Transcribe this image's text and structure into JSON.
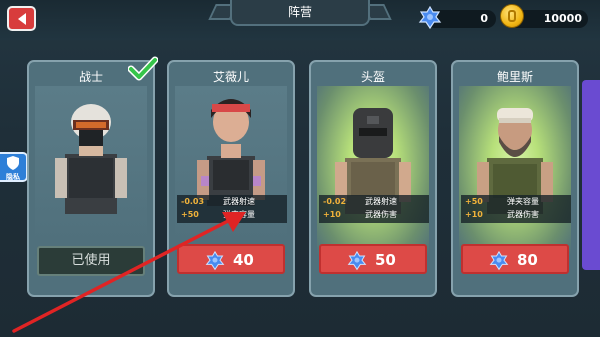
{
  "header": {
    "title": "阵营",
    "gems": "0",
    "coins": "10000"
  },
  "privacy": {
    "label": "隐私"
  },
  "cards": [
    {
      "name": "战士",
      "status": "已使用",
      "stats": []
    },
    {
      "name": "艾薇儿",
      "price": "40",
      "stats": [
        {
          "delta": "-0.03",
          "label": "武器射速"
        },
        {
          "delta": "+50",
          "label": "弹夹容量"
        }
      ]
    },
    {
      "name": "头盔",
      "price": "50",
      "stats": [
        {
          "delta": "-0.02",
          "label": "武器射速"
        },
        {
          "delta": "+10",
          "label": "武器伤害"
        }
      ]
    },
    {
      "name": "鲍里斯",
      "price": "80",
      "stats": [
        {
          "delta": "+50",
          "label": "弹夹容量"
        },
        {
          "delta": "+10",
          "label": "武器伤害"
        }
      ]
    }
  ],
  "colors": {
    "accent_red": "#dd4a47",
    "gem_blue": "#4a8bf0",
    "coin_gold": "#f1b615",
    "stat_orange": "#f0b23a",
    "check_green": "#36c54a",
    "arrow_red": "#e02424"
  },
  "icons": {
    "back": "chevron-left-icon",
    "gem": "gem-icon",
    "coin": "coin-icon",
    "privacy": "shield-icon",
    "selected": "check-icon"
  }
}
